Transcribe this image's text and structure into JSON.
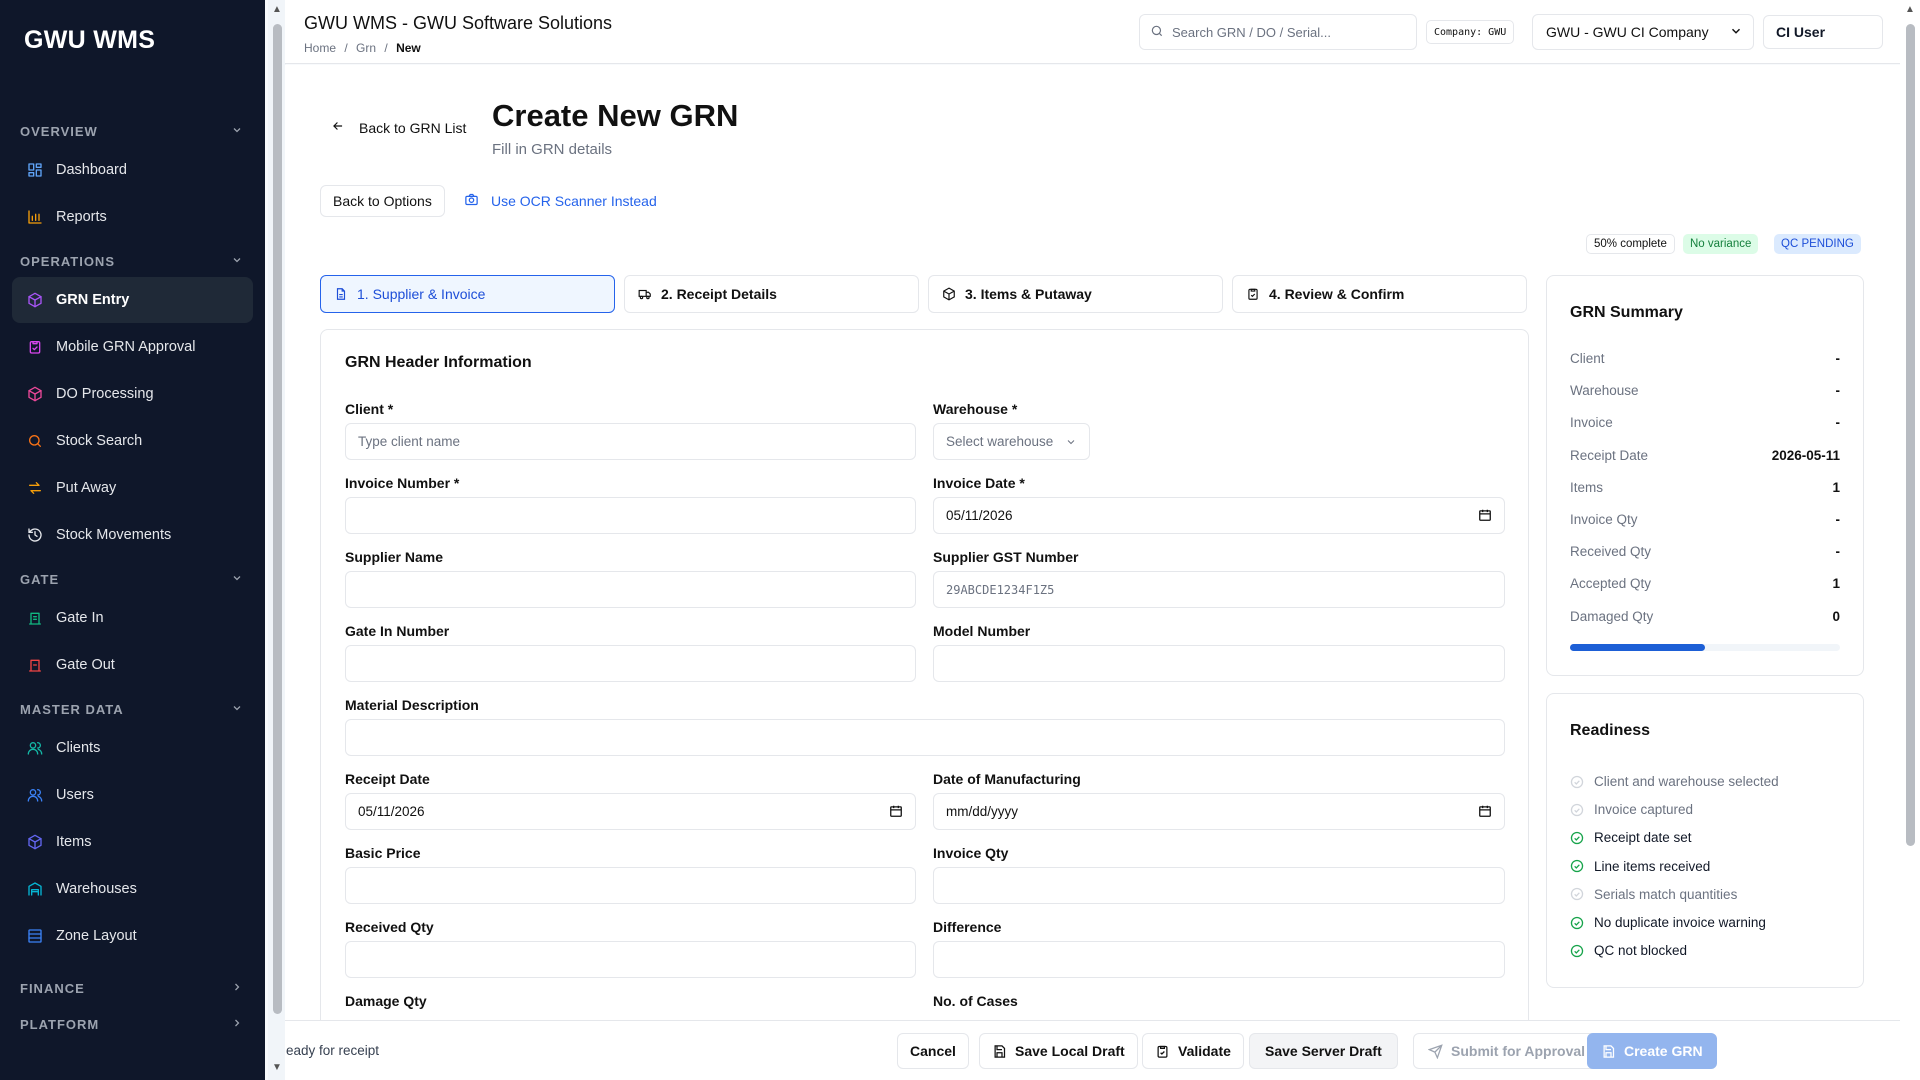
{
  "sidebar": {
    "brand": "GWU WMS",
    "sections": [
      {
        "label": "OVERVIEW",
        "expanded": true,
        "items": [
          {
            "label": "Dashboard",
            "icon": "dashboard-icon",
            "color": "#60a5fa"
          },
          {
            "label": "Reports",
            "icon": "bar-chart-icon",
            "color": "#f59e0b"
          }
        ]
      },
      {
        "label": "OPERATIONS",
        "expanded": true,
        "items": [
          {
            "label": "GRN Entry",
            "icon": "package-icon",
            "color": "#a855f7",
            "active": true
          },
          {
            "label": "Mobile GRN Approval",
            "icon": "clipboard-check-icon",
            "color": "#d946ef"
          },
          {
            "label": "DO Processing",
            "icon": "package-icon",
            "color": "#ec4899"
          },
          {
            "label": "Stock Search",
            "icon": "search-icon",
            "color": "#f97316"
          },
          {
            "label": "Put Away",
            "icon": "arrows-icon",
            "color": "#f59e0b"
          },
          {
            "label": "Stock Movements",
            "icon": "history-icon",
            "color": "#e5e7eb"
          }
        ]
      },
      {
        "label": "GATE",
        "expanded": true,
        "items": [
          {
            "label": "Gate In",
            "icon": "gate-in-icon",
            "color": "#10b981"
          },
          {
            "label": "Gate Out",
            "icon": "gate-out-icon",
            "color": "#ef4444"
          }
        ]
      },
      {
        "label": "MASTER DATA",
        "expanded": true,
        "items": [
          {
            "label": "Clients",
            "icon": "users-icon",
            "color": "#14b8a6"
          },
          {
            "label": "Users",
            "icon": "users-icon",
            "color": "#3b82f6"
          },
          {
            "label": "Items",
            "icon": "cube-icon",
            "color": "#6366f1"
          },
          {
            "label": "Warehouses",
            "icon": "warehouse-icon",
            "color": "#06b6d4"
          },
          {
            "label": "Zone Layout",
            "icon": "layout-icon",
            "color": "#3b82f6"
          }
        ]
      },
      {
        "label": "FINANCE",
        "expanded": false,
        "items": []
      },
      {
        "label": "PLATFORM",
        "expanded": false,
        "items": []
      }
    ]
  },
  "header": {
    "title": "GWU WMS - GWU Software Solutions",
    "breadcrumb": [
      "Home",
      "Grn",
      "New"
    ],
    "search_placeholder": "Search GRN / DO / Serial...",
    "company_tag": "Company: GWU",
    "company_select": "GWU - GWU CI Company",
    "user": "CI User"
  },
  "page": {
    "back_label": "Back to GRN List",
    "title": "Create New GRN",
    "subtitle": "Fill in GRN details",
    "back_options": "Back to Options",
    "ocr_label": "Use OCR Scanner Instead",
    "pills": {
      "complete": "50% complete",
      "variance": "No variance",
      "qc": "QC PENDING"
    },
    "colors": {
      "accent": "#2563eb",
      "variance_bg": "#dcfce7",
      "qc_bg": "#dbeafe",
      "success": "#16a34a"
    }
  },
  "steps": [
    "1. Supplier & Invoice",
    "2. Receipt Details",
    "3. Items & Putaway",
    "4. Review & Confirm"
  ],
  "form": {
    "title": "GRN Header Information",
    "client": {
      "label": "Client *",
      "placeholder": "Type client name"
    },
    "warehouse": {
      "label": "Warehouse *",
      "placeholder": "Select warehouse"
    },
    "invoice_number": {
      "label": "Invoice Number *",
      "value": ""
    },
    "invoice_date": {
      "label": "Invoice Date *",
      "value": "05/11/2026"
    },
    "supplier_name": {
      "label": "Supplier Name",
      "value": ""
    },
    "supplier_gst": {
      "label": "Supplier GST Number",
      "placeholder": "29ABCDE1234F1Z5"
    },
    "gate_in": {
      "label": "Gate In Number",
      "value": ""
    },
    "model_number": {
      "label": "Model Number",
      "value": ""
    },
    "material_description": {
      "label": "Material Description",
      "value": ""
    },
    "receipt_date": {
      "label": "Receipt Date",
      "value": "05/11/2026"
    },
    "dom": {
      "label": "Date of Manufacturing",
      "value": "mm/dd/yyyy"
    },
    "basic_price": {
      "label": "Basic Price",
      "value": ""
    },
    "invoice_qty": {
      "label": "Invoice Qty",
      "value": ""
    },
    "received_qty": {
      "label": "Received Qty",
      "value": ""
    },
    "difference": {
      "label": "Difference",
      "value": ""
    },
    "damage_qty": {
      "label": "Damage Qty",
      "value": ""
    },
    "cases": {
      "label": "No. of Cases",
      "value": ""
    }
  },
  "summary": {
    "title": "GRN Summary",
    "rows": [
      {
        "k": "Client",
        "v": "-"
      },
      {
        "k": "Warehouse",
        "v": "-"
      },
      {
        "k": "Invoice",
        "v": "-"
      },
      {
        "k": "Receipt Date",
        "v": "2026-05-11"
      },
      {
        "k": "Items",
        "v": "1"
      },
      {
        "k": "Invoice Qty",
        "v": "-"
      },
      {
        "k": "Received Qty",
        "v": "-"
      },
      {
        "k": "Accepted Qty",
        "v": "1"
      },
      {
        "k": "Damaged Qty",
        "v": "0"
      }
    ],
    "progress_fraction": 0.5
  },
  "readiness": {
    "title": "Readiness",
    "items": [
      {
        "label": "Client and warehouse selected",
        "done": false
      },
      {
        "label": "Invoice captured",
        "done": false
      },
      {
        "label": "Receipt date set",
        "done": true
      },
      {
        "label": "Line items received",
        "done": true
      },
      {
        "label": "Serials match quantities",
        "done": false
      },
      {
        "label": "No duplicate invoice warning",
        "done": true
      },
      {
        "label": "QC not blocked",
        "done": true
      }
    ]
  },
  "footer": {
    "status": "eady for receipt",
    "cancel": "Cancel",
    "save_local": "Save Local Draft",
    "validate": "Validate",
    "save_server": "Save Server Draft",
    "submit": "Submit for Approval",
    "create": "Create GRN"
  }
}
